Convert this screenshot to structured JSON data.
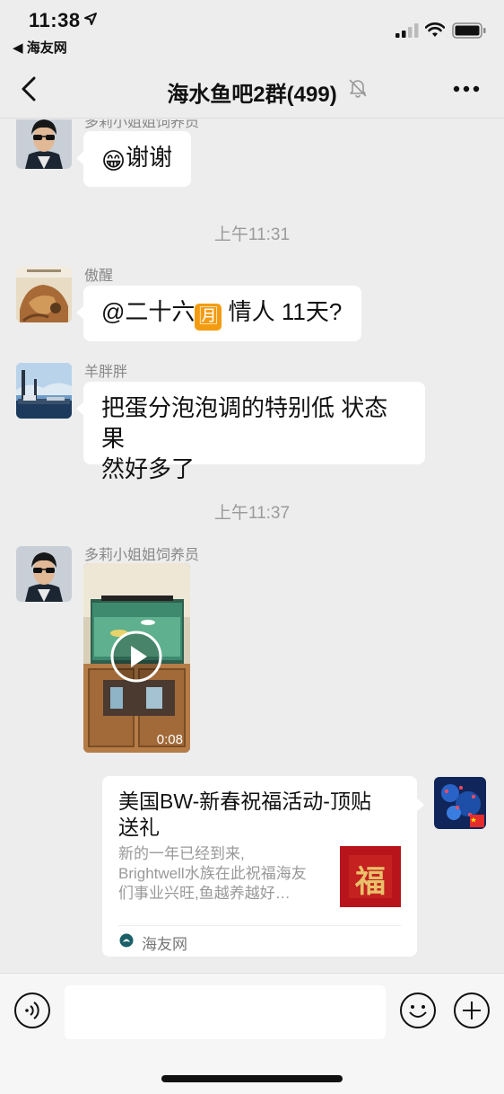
{
  "status_bar": {
    "time": "11:38",
    "back_app": "◀ 海友网"
  },
  "nav": {
    "title": "海水鱼吧2群(499)"
  },
  "messages": [
    {
      "sender": "多莉小姐姐饲养员",
      "emoji": "😁",
      "text": "谢谢"
    },
    {
      "sender": "傲醒",
      "text_before": "@二十六",
      "emoji": "🈷",
      "text_after": " 情人 11天?"
    },
    {
      "sender": "羊胖胖",
      "text_line1": "把蛋分泡泡调的特别低 状态果",
      "text_line2": "然好多了"
    },
    {
      "sender": "多莉小姐姐饲养员",
      "video_duration": "0:08"
    }
  ],
  "timestamps": [
    "上午11:31",
    "上午11:37"
  ],
  "link_card": {
    "title_line1": "美国BW-新春祝福活动-顶贴",
    "title_line2": "送礼",
    "desc_line1": "新的一年已经到来,",
    "desc_line2": "Brightwell水族在此祝福海友",
    "desc_line3": "们事业兴旺,鱼越养越好…",
    "thumb_char": "福",
    "source": "海友网"
  },
  "input": {
    "placeholder": ""
  },
  "colors": {
    "background": "#ededed",
    "bubble": "#ffffff",
    "source_icon": "#1a5f66",
    "card_thumb": "#b8141b"
  },
  "icons": [
    "location-arrow-icon",
    "signal-icon",
    "wifi-icon",
    "battery-icon",
    "chevron-left-icon",
    "mute-bell-icon",
    "more-dots-icon",
    "play-icon",
    "voice-icon",
    "emoji-face-icon",
    "plus-circle-icon"
  ]
}
